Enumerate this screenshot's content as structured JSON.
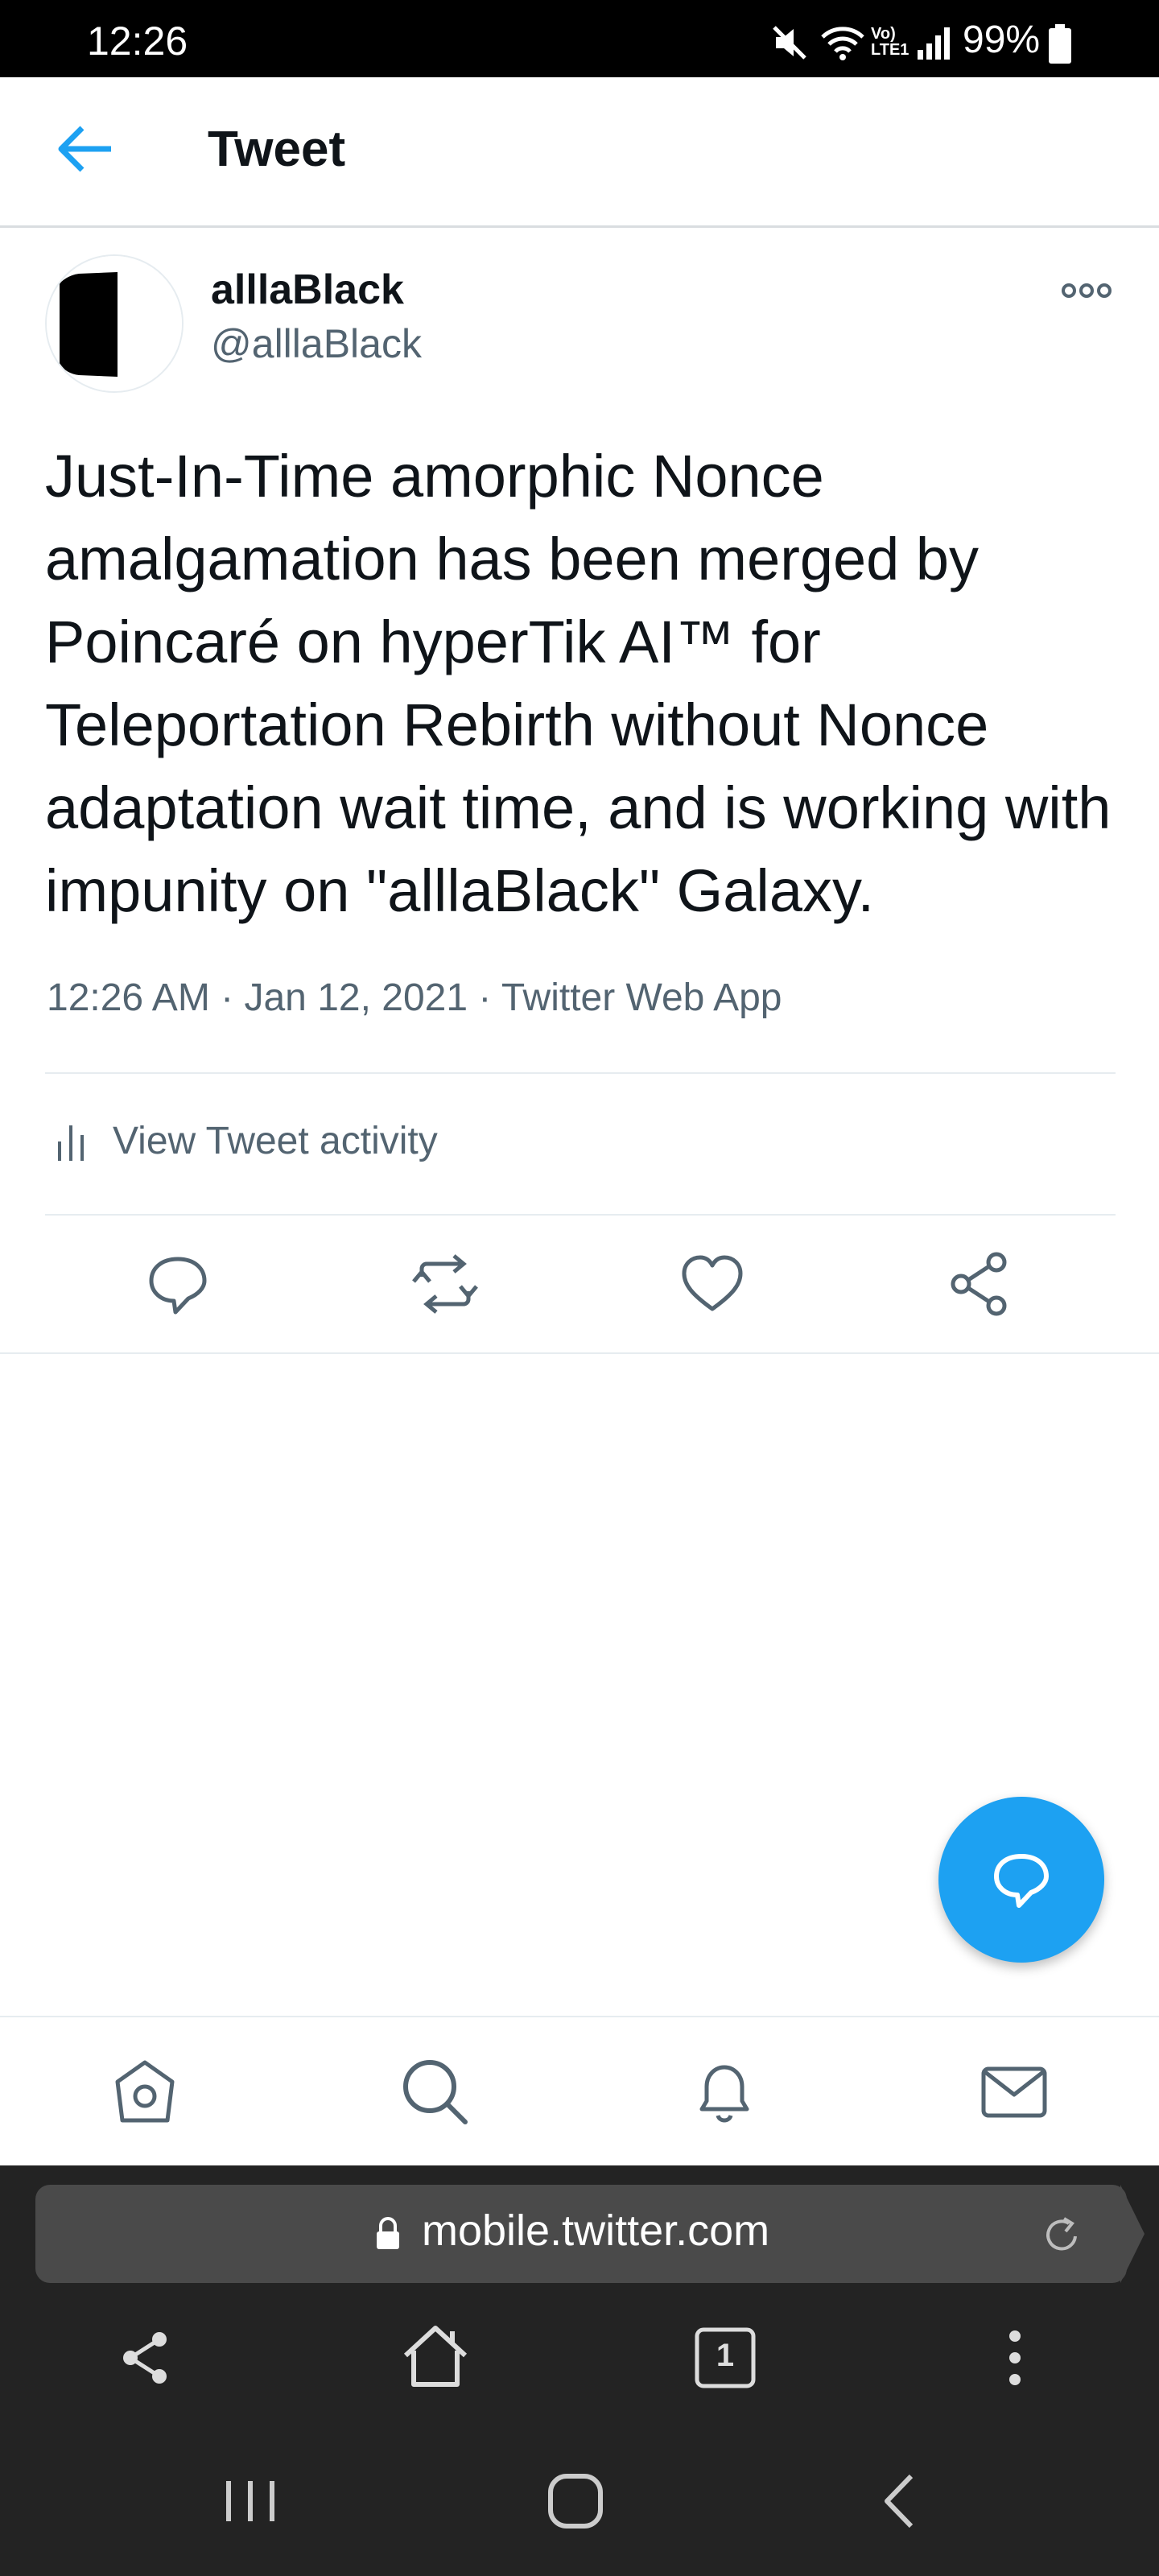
{
  "status_bar": {
    "time": "12:26",
    "network": "Vo) LTE1",
    "battery": "99%"
  },
  "header": {
    "title": "Tweet"
  },
  "tweet": {
    "display_name": "alllaBlack",
    "handle": "@alllaBlack",
    "text": "Just-In-Time amorphic Nonce amalgamation has been merged by Poincaré on hyperTik AI™ for Teleportation Rebirth without Nonce adaptation wait time, and is working with impunity on \"alllaBlack\" Galaxy.",
    "time": "12:26 AM",
    "date": "Jan 12, 2021",
    "source": "Twitter Web App",
    "activity_label": "View Tweet activity"
  },
  "browser": {
    "url": "mobile.twitter.com",
    "tab_count": "1"
  },
  "colors": {
    "accent": "#1da1f2",
    "secondary_text": "#536471",
    "browser_bg": "#232323"
  }
}
